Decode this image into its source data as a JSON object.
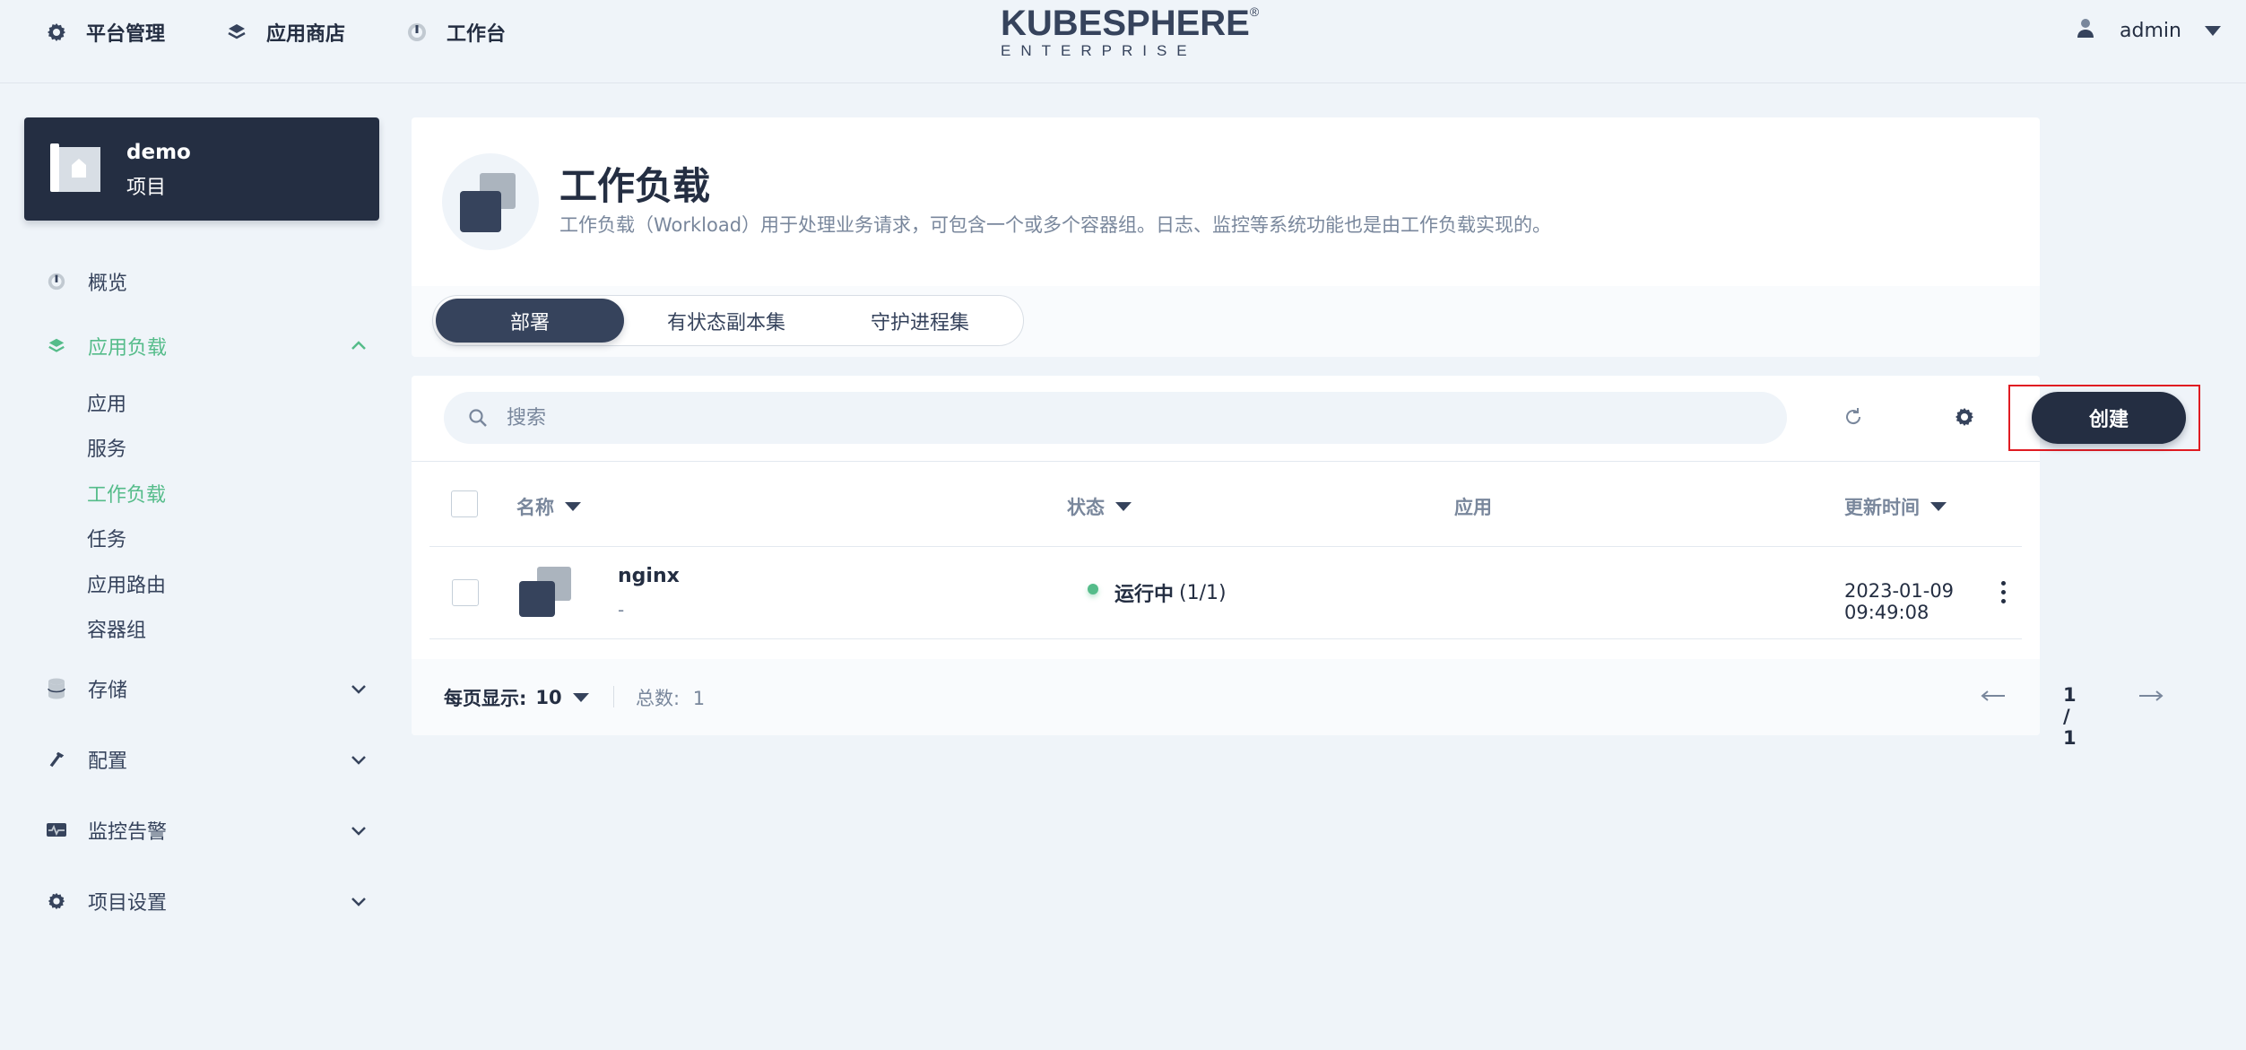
{
  "topnav": {
    "items": [
      {
        "label": "平台管理",
        "icon": "gear-icon"
      },
      {
        "label": "应用商店",
        "icon": "layers-icon"
      },
      {
        "label": "工作台",
        "icon": "dashboard-icon"
      }
    ],
    "logo": {
      "name": "KUBESPHERE",
      "mark": "®",
      "tagline": "ENTERPRISE"
    },
    "user": {
      "name": "admin"
    }
  },
  "project": {
    "name": "demo",
    "type": "项目"
  },
  "sidebar": {
    "overview": "概览",
    "app_workloads": "应用负载",
    "sub_items": [
      "应用",
      "服务",
      "工作负载",
      "任务",
      "应用路由",
      "容器组"
    ],
    "storage": "存储",
    "config": "配置",
    "monitoring": "监控告警",
    "settings": "项目设置"
  },
  "page": {
    "title": "工作负载",
    "description": "工作负载（Workload）用于处理业务请求，可包含一个或多个容器组。日志、监控等系统功能也是由工作负载实现的。",
    "tabs": [
      "部署",
      "有状态副本集",
      "守护进程集"
    ],
    "active_tab": 0
  },
  "toolbar": {
    "search_placeholder": "搜索",
    "create_label": "创建"
  },
  "table": {
    "headers": {
      "name": "名称",
      "status": "状态",
      "app": "应用",
      "updated": "更新时间"
    },
    "rows": [
      {
        "name": "nginx",
        "desc": "-",
        "status": "运行中",
        "replicas": "(1/1)",
        "app": "",
        "updated": "2023-01-09 09:49:08"
      }
    ]
  },
  "footer": {
    "per_page_label": "每页显示:",
    "per_page_value": "10",
    "total_label": "总数:",
    "total_value": "1",
    "page_text": "1 / 1"
  },
  "colors": {
    "primary_dark": "#242e42",
    "accent_green": "#55bc8a",
    "highlight_red": "#e01b22",
    "bg": "#eff4f9"
  }
}
